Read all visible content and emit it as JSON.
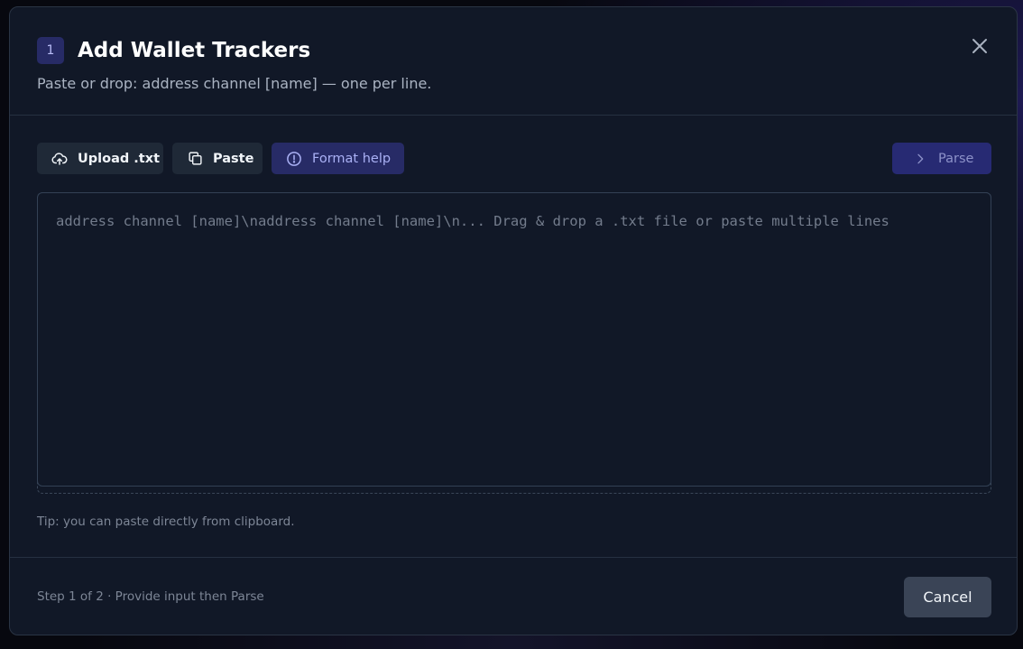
{
  "modal": {
    "step_number": "1",
    "title": "Add Wallet Trackers",
    "subtitle": "Paste or drop: address channel [name] — one per line."
  },
  "toolbar": {
    "upload_label": "Upload .txt",
    "paste_label": "Paste",
    "format_help_label": "Format help",
    "parse_label": "Parse"
  },
  "input": {
    "value": "",
    "placeholder": "address channel [name]\\naddress channel [name]\\n... Drag & drop a .txt file or paste multiple lines"
  },
  "tip": "Tip: you can paste directly from clipboard.",
  "footer": {
    "status": "Step 1 of 2 · Provide input then Parse",
    "cancel_label": "Cancel"
  },
  "icons": {
    "upload": "cloud-upload-icon",
    "paste": "copy-icon",
    "format_help": "alert-circle-icon",
    "parse": "chevron-right-icon",
    "close": "close-icon"
  },
  "colors": {
    "accent": "#272b66",
    "accent_text": "#aab1f5",
    "background": "#111827",
    "button_neutral": "#1f2937",
    "cancel_button": "#3a4456"
  }
}
